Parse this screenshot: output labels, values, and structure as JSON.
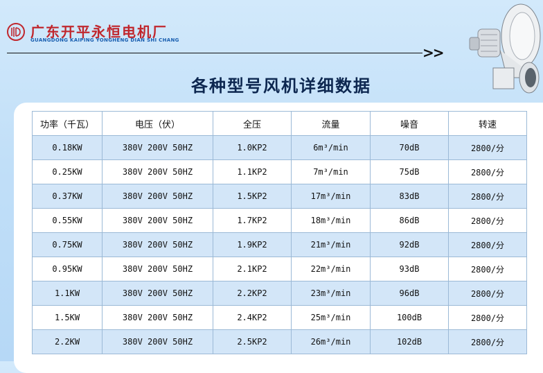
{
  "header": {
    "company_cn": "广东开平永恒电机厂",
    "company_en": "GUANGDONG KAIPING YONGHENG DIAN SHI CHANG",
    "arrows": ">>"
  },
  "title": "各种型号风机详细数据",
  "table": {
    "columns": [
      "功率（千瓦）",
      "电压（伏）",
      "全压",
      "流量",
      "噪音",
      "转速"
    ],
    "rows": [
      [
        "0.18KW",
        "380V 200V 50HZ",
        "1.0KP2",
        "6m³/min",
        "70dB",
        "2800/分"
      ],
      [
        "0.25KW",
        "380V 200V 50HZ",
        "1.1KP2",
        "7m³/min",
        "75dB",
        "2800/分"
      ],
      [
        "0.37KW",
        "380V 200V 50HZ",
        "1.5KP2",
        "17m³/min",
        "83dB",
        "2800/分"
      ],
      [
        "0.55KW",
        "380V 200V 50HZ",
        "1.7KP2",
        "18m³/min",
        "86dB",
        "2800/分"
      ],
      [
        "0.75KW",
        "380V 200V 50HZ",
        "1.9KP2",
        "21m³/min",
        "92dB",
        "2800/分"
      ],
      [
        "0.95KW",
        "380V 200V 50HZ",
        "2.1KP2",
        "22m³/min",
        "93dB",
        "2800/分"
      ],
      [
        "1.1KW",
        "380V 200V 50HZ",
        "2.2KP2",
        "23m³/min",
        "96dB",
        "2800/分"
      ],
      [
        "1.5KW",
        "380V 200V 50HZ",
        "2.4KP2",
        "25m³/min",
        "100dB",
        "2800/分"
      ],
      [
        "2.2KW",
        "380V 200V 50HZ",
        "2.5KP2",
        "26m³/min",
        "102dB",
        "2800/分"
      ]
    ]
  },
  "colors": {
    "brand_red": "#c0272d",
    "title_navy": "#0d2750",
    "row_blue": "#d3e6f8"
  }
}
